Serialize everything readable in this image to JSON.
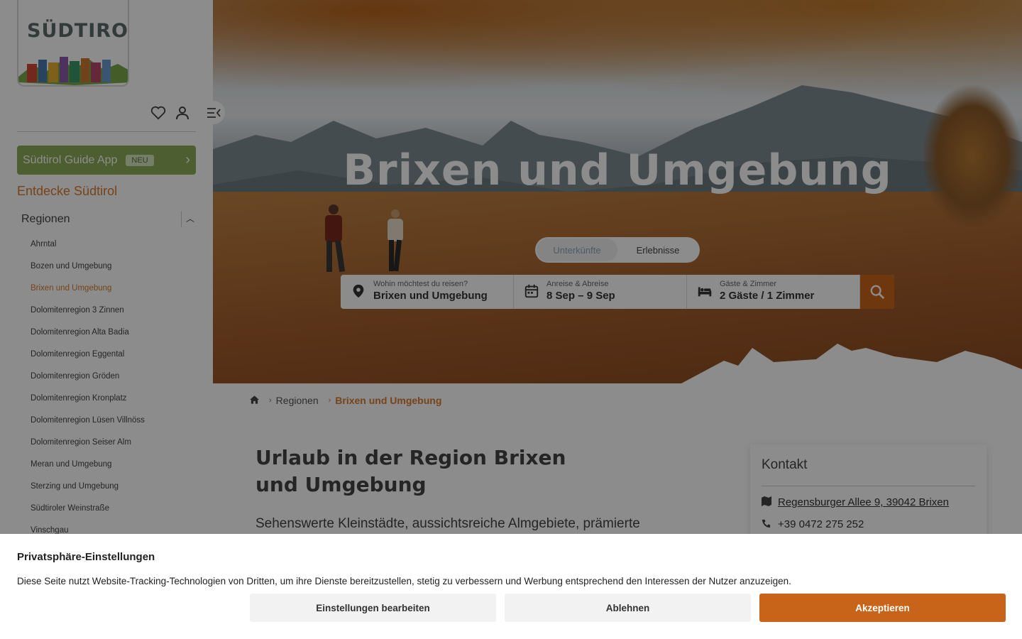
{
  "brand": {
    "logo_text": "SÜDTIROL"
  },
  "sidebar": {
    "guide_app_label": "Südtirol Guide App",
    "guide_app_badge": "NEU",
    "discover_heading": "Entdecke Südtirol",
    "section_label": "Regionen",
    "regions": [
      "Ahrntal",
      "Bozen und Umgebung",
      "Brixen und Umgebung",
      "Dolomitenregion 3 Zinnen",
      "Dolomitenregion Alta Badia",
      "Dolomitenregion Eggental",
      "Dolomitenregion Gröden",
      "Dolomitenregion Kronplatz",
      "Dolomitenregion Lüsen Villnöss",
      "Dolomitenregion Seiser Alm",
      "Meran und Umgebung",
      "Sterzing und Umgebung",
      "Südtiroler Weinstraße",
      "Vinschgau"
    ],
    "active_region": "Brixen und Umgebung"
  },
  "hero": {
    "title": "Brixen und Umgebung",
    "tabs": [
      "Unterkünfte",
      "Erlebnisse"
    ],
    "active_tab": "Unterkünfte",
    "search": {
      "destination_label": "Wohin möchtest du reisen?",
      "destination_value": "Brixen und Umgebung",
      "dates_label": "Anreise & Abreise",
      "dates_value": "8 Sep – 9 Sep",
      "guests_label": "Gäste & Zimmer",
      "guests_value": "2 Gäste / 1 Zimmer"
    }
  },
  "breadcrumb": {
    "items": [
      "Regionen",
      "Brixen und Umgebung"
    ]
  },
  "main": {
    "title": "Urlaub in der Region Brixen und Umgebung",
    "intro": "Sehenswerte Kleinstädte, aussichtsreiche Almgebiete, prämierte"
  },
  "contact": {
    "heading": "Kontakt",
    "address": "Regensburger Allee 9, 39042 Brixen",
    "phone": "+39 0472 275 252"
  },
  "cookie": {
    "title": "Privatsphäre-Einstellungen",
    "text": "Diese Seite nutzt Website-Tracking-Technologien von Dritten, um ihre Dienste bereitzustellen, stetig zu verbessern und Werbung entsprechend den Interessen der Nutzer anzuzeigen.",
    "edit_label": "Einstellungen bearbeiten",
    "reject_label": "Ablehnen",
    "accept_label": "Akzeptieren"
  },
  "colors": {
    "accent": "#c8641a",
    "brand_orange": "#d97a2e",
    "guide_green": "#8cae58"
  },
  "icons": [
    "heart-icon",
    "user-icon",
    "menu-toggle-icon",
    "location-pin-icon",
    "calendar-icon",
    "bed-icon",
    "search-icon",
    "home-icon",
    "map-icon",
    "phone-icon"
  ]
}
